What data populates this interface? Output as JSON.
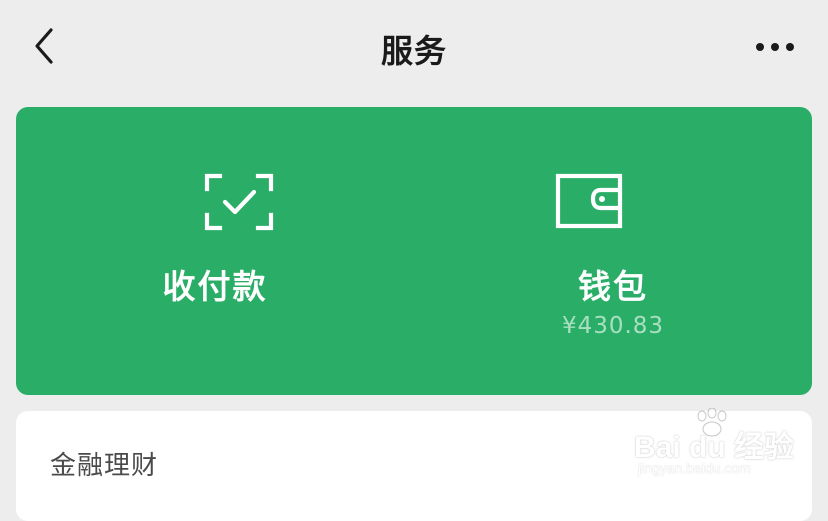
{
  "header": {
    "title": "服务",
    "back_icon": "chevron-left-icon",
    "more_icon": "more-horizontal-icon"
  },
  "wallet_card": {
    "background_color": "#2aae67",
    "pay": {
      "icon": "scan-check-icon",
      "label": "收付款"
    },
    "wallet": {
      "icon": "wallet-icon",
      "label": "钱包",
      "balance": "¥430.83"
    }
  },
  "sections": [
    {
      "title": "金融理财"
    }
  ],
  "watermark": {
    "main": "Bai du 经验",
    "sub": "jingyan.baidu.com"
  }
}
